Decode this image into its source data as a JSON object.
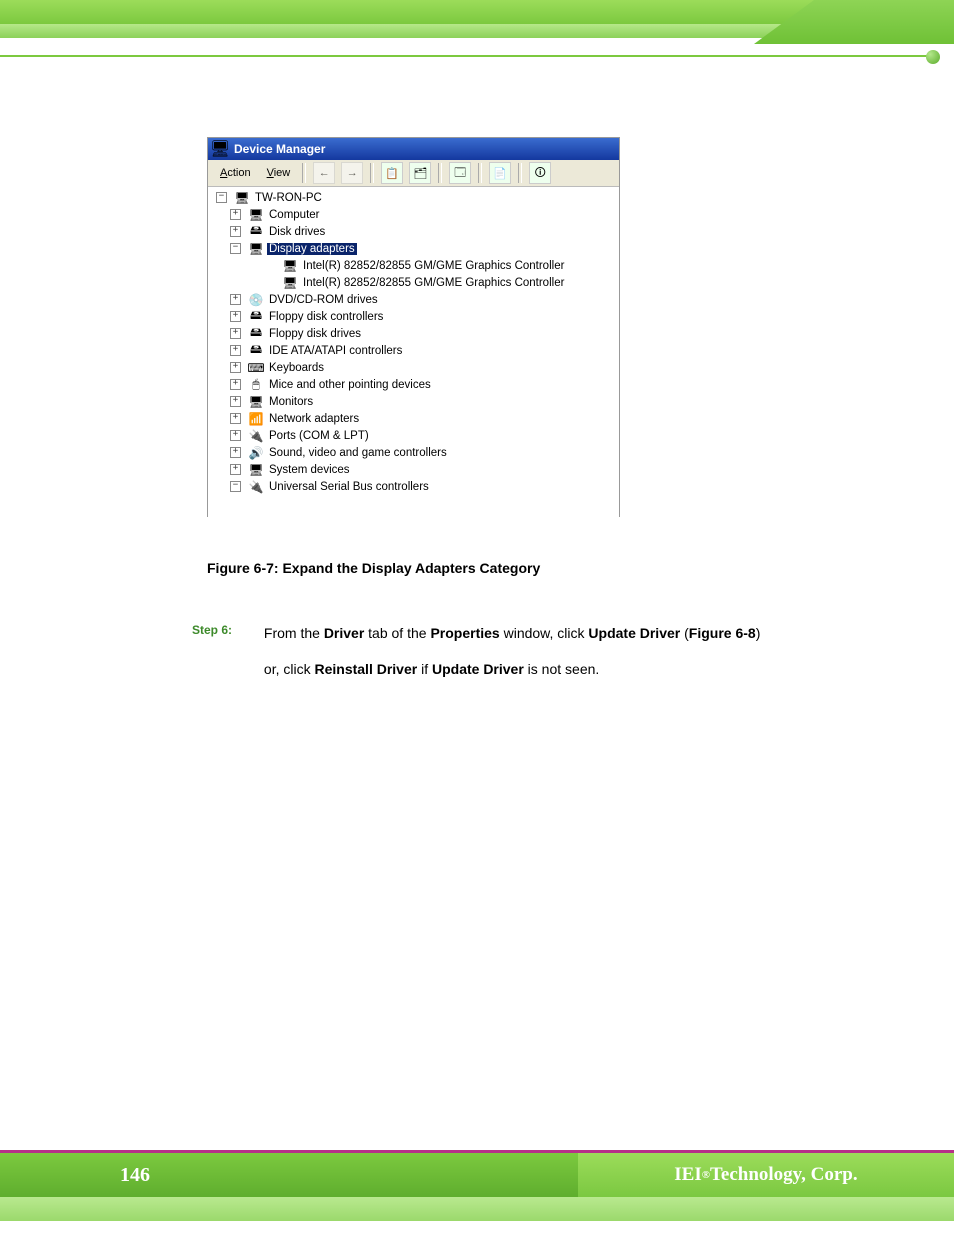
{
  "header": {},
  "device_manager": {
    "title": "Device Manager",
    "menu": {
      "action": "Action",
      "view": "View"
    },
    "toolbar": {
      "back": "←",
      "forward": "→",
      "b1": "📋",
      "b2": "🗂",
      "b3": "🗔",
      "b4": "📄",
      "b5": "🛈"
    },
    "root": "TW-RON-PC",
    "items": [
      {
        "label": "Computer",
        "icon": "🖥",
        "exp": "+"
      },
      {
        "label": "Disk drives",
        "icon": "🖴",
        "exp": "+"
      },
      {
        "label": "Display adapters",
        "icon": "🖥",
        "exp": "−",
        "selected": true,
        "children": [
          {
            "label": "Intel(R) 82852/82855 GM/GME Graphics Controller",
            "icon": "🖥"
          },
          {
            "label": "Intel(R) 82852/82855 GM/GME Graphics Controller",
            "icon": "🖥"
          }
        ]
      },
      {
        "label": "DVD/CD-ROM drives",
        "icon": "💿",
        "exp": "+"
      },
      {
        "label": "Floppy disk controllers",
        "icon": "🖴",
        "exp": "+"
      },
      {
        "label": "Floppy disk drives",
        "icon": "🖴",
        "exp": "+"
      },
      {
        "label": "IDE ATA/ATAPI controllers",
        "icon": "🖴",
        "exp": "+"
      },
      {
        "label": "Keyboards",
        "icon": "⌨",
        "exp": "+"
      },
      {
        "label": "Mice and other pointing devices",
        "icon": "🖱",
        "exp": "+"
      },
      {
        "label": "Monitors",
        "icon": "🖥",
        "exp": "+"
      },
      {
        "label": "Network adapters",
        "icon": "📶",
        "exp": "+"
      },
      {
        "label": "Ports (COM & LPT)",
        "icon": "🔌",
        "exp": "+"
      },
      {
        "label": "Sound, video and game controllers",
        "icon": "🔊",
        "exp": "+"
      },
      {
        "label": "System devices",
        "icon": "🖥",
        "exp": "+"
      },
      {
        "label": "Universal Serial Bus controllers",
        "icon": "🔌",
        "exp": "−"
      }
    ]
  },
  "caption": "Figure 6-7: Expand the Display Adapters Category",
  "step": {
    "label": "Step 6:",
    "text_before": "From the ",
    "b1": "Driver",
    "t2": " tab of the ",
    "b2": "Properties",
    "t3": " window, click ",
    "b3": "Update Driver",
    "t4": " (",
    "b4": "Figure 6-8",
    "t5": ")",
    "line2a": "or, click ",
    "b5": "Reinstall Driver",
    "t6": " if ",
    "b6": "Update Driver",
    "t7": " is not seen."
  },
  "footer": {
    "page": "146",
    "brand_pre": "IEI",
    "brand_sup": "®",
    "brand_post": " Technology, Corp."
  }
}
